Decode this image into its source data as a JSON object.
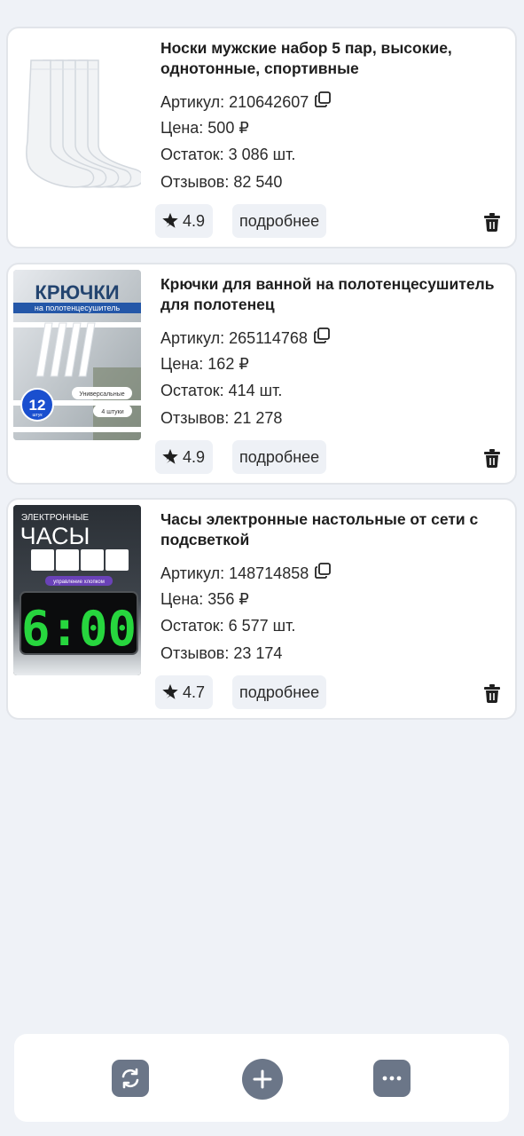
{
  "products": [
    {
      "title": "Носки мужские набор 5 пар, высокие, однотонные, спортивные",
      "article_label": "Артикул:",
      "article": "210642607",
      "price_label": "Цена:",
      "price": "500 ₽",
      "stock_label": "Остаток:",
      "stock": "3 086 шт.",
      "reviews_label": "Отзывов:",
      "reviews": "82 540",
      "rating": "4.9",
      "more_label": "подробнее"
    },
    {
      "title": "Крючки для ванной на полотенцесушитель для полотенец",
      "article_label": "Артикул:",
      "article": "265114768",
      "price_label": "Цена:",
      "price": "162 ₽",
      "stock_label": "Остаток:",
      "stock": "414 шт.",
      "reviews_label": "Отзывов:",
      "reviews": "21 278",
      "rating": "4.9",
      "more_label": "подробнее",
      "image_text": {
        "headline": "КРЮЧКИ",
        "sub": "на полотенцесушитель",
        "badge_num": "12",
        "badge_unit": "штук",
        "tag1": "Универсальные",
        "tag2": "4 штуки"
      }
    },
    {
      "title": "Часы электронные настольные от сети с подсветкой",
      "article_label": "Артикул:",
      "article": "148714858",
      "price_label": "Цена:",
      "price": "356 ₽",
      "stock_label": "Остаток:",
      "stock": "6 577 шт.",
      "reviews_label": "Отзывов:",
      "reviews": "23 174",
      "rating": "4.7",
      "more_label": "подробнее",
      "image_text": {
        "line1": "ЭЛЕКТРОННЫЕ",
        "line2": "ЧАСЫ",
        "strip": "управление хлопком",
        "clock": "6:00"
      }
    }
  ],
  "colors": {
    "background": "#eff2f7",
    "card": "#ffffff",
    "chip": "#eef1f6",
    "action_button": "#6b7688",
    "clock_digits": "#27d63e"
  },
  "icons": {
    "copy": "copy-icon",
    "rating": "star-hand-icon",
    "trash": "trash-icon",
    "refresh": "refresh-icon",
    "add": "plus-icon",
    "menu": "more-dots-icon"
  }
}
